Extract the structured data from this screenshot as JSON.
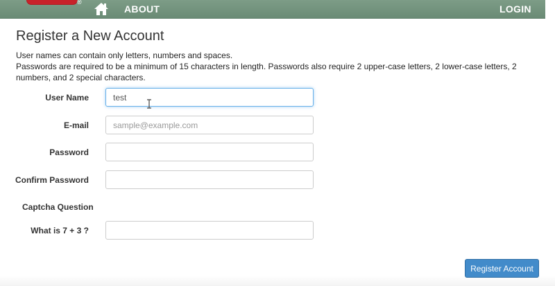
{
  "nav": {
    "reg_mark": "®",
    "about_label": "ABOUT",
    "login_label": "LOGIN",
    "home_icon": "home-icon"
  },
  "page": {
    "title": "Register a New Account",
    "help_line1": "User names can contain only letters, numbers and spaces.",
    "help_line2": "Passwords are required to be a minimum of 15 characters in length. Passwords also require 2 upper-case letters, 2 lower-case letters, 2 numbers, and 2 special characters."
  },
  "form": {
    "username_label": "User Name",
    "username_value": "test",
    "email_label": "E-mail",
    "email_placeholder": "sample@example.com",
    "password_label": "Password",
    "confirm_label": "Confirm Password",
    "captcha_section": "Captcha Question",
    "captcha_question": "What is 7 + 3 ?",
    "captcha_value": "",
    "submit_label": "Register Account"
  },
  "colors": {
    "navbar": "#6a8b75",
    "brand_red": "#c8222a",
    "primary_button": "#428bca",
    "focus_border": "#66afe9"
  }
}
